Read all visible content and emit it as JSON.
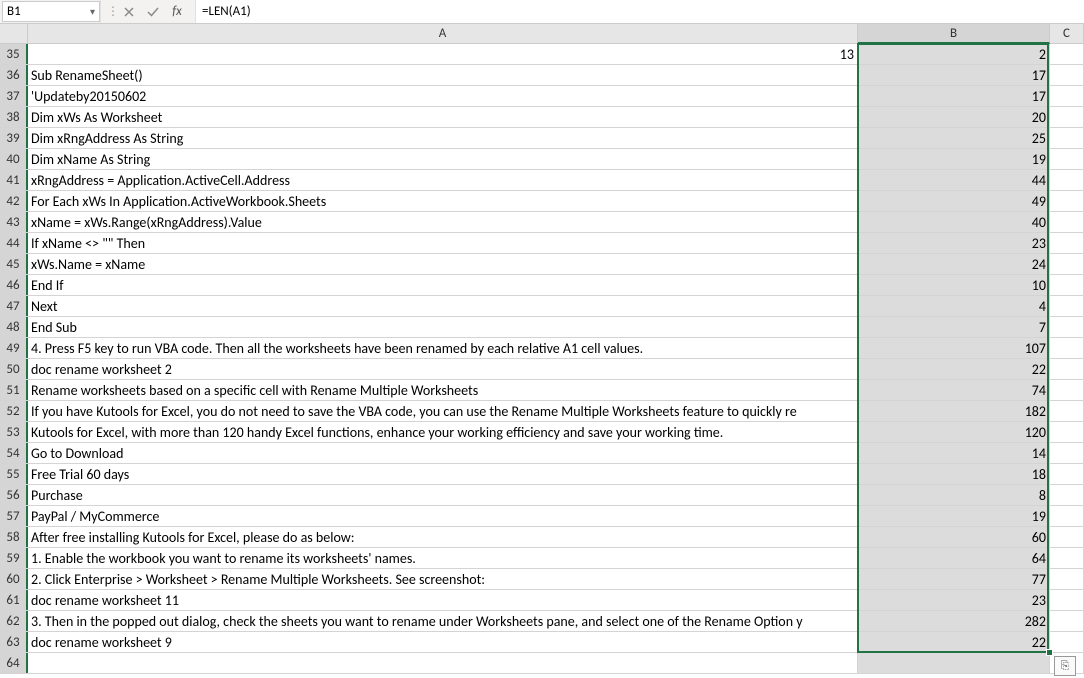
{
  "nameBox": "B1",
  "formula": "=LEN(A1)",
  "cols": [
    {
      "id": "A",
      "label": "A",
      "cls": "colA"
    },
    {
      "id": "B",
      "label": "B",
      "cls": "colB"
    },
    {
      "id": "C",
      "label": "C",
      "cls": "colC"
    }
  ],
  "rows": [
    {
      "n": 35,
      "A": "13",
      "Anum": true,
      "B": "2"
    },
    {
      "n": 36,
      "A": "Sub RenameSheet()",
      "B": "17"
    },
    {
      "n": 37,
      "A": "'Updateby20150602",
      "B": "17"
    },
    {
      "n": 38,
      "A": "Dim xWs As Worksheet",
      "B": "20"
    },
    {
      "n": 39,
      "A": "Dim xRngAddress As String",
      "B": "25"
    },
    {
      "n": 40,
      "A": "Dim xName As String",
      "B": "19"
    },
    {
      "n": 41,
      "A": "xRngAddress = Application.ActiveCell.Address",
      "B": "44"
    },
    {
      "n": 42,
      "A": "For Each xWs In Application.ActiveWorkbook.Sheets",
      "B": "49"
    },
    {
      "n": 43,
      "A": "    xName = xWs.Range(xRngAddress).Value",
      "B": "40"
    },
    {
      "n": 44,
      "A": "    If xName <> \"\" Then",
      "B": "23"
    },
    {
      "n": 45,
      "A": "        xWs.Name = xName",
      "B": "24"
    },
    {
      "n": 46,
      "A": "    End If",
      "B": "10"
    },
    {
      "n": 47,
      "A": "Next",
      "B": "4"
    },
    {
      "n": 48,
      "A": "End Sub",
      "B": "7"
    },
    {
      "n": 49,
      "A": "4. Press F5 key to run VBA code. Then all the worksheets have been renamed by each relative A1 cell values.",
      "B": "107"
    },
    {
      "n": 50,
      "A": "doc rename worksheet 2",
      "B": "22"
    },
    {
      "n": 51,
      "A": "Rename worksheets based on a specific cell with Rename Multiple Worksheets",
      "B": "74"
    },
    {
      "n": 52,
      "A": "If you have Kutools for Excel, you do not need to save the VBA code, you can use the Rename Multiple Worksheets feature to quickly re",
      "B": "182"
    },
    {
      "n": 53,
      "A": "Kutools for Excel, with more than 120 handy Excel functions, enhance your working efficiency and save your working time.",
      "B": "120"
    },
    {
      "n": 54,
      "A": "Go to Download",
      "B": "14"
    },
    {
      "n": 55,
      "A": "Free Trial 60 days",
      "B": "18"
    },
    {
      "n": 56,
      "A": "Purchase",
      "B": "8"
    },
    {
      "n": 57,
      "A": "PayPal / MyCommerce",
      "B": "19"
    },
    {
      "n": 58,
      "A": "After free installing Kutools for Excel, please do as below:",
      "B": "60"
    },
    {
      "n": 59,
      "A": "1. Enable the workbook you want to rename its worksheets' names.",
      "B": "64"
    },
    {
      "n": 60,
      "A": "2. Click Enterprise > Worksheet > Rename Multiple Worksheets. See screenshot:",
      "B": "77"
    },
    {
      "n": 61,
      "A": "doc rename worksheet 11",
      "B": "23"
    },
    {
      "n": 62,
      "A": "3. Then in the popped out dialog, check the sheets you want to rename under Worksheets pane, and select one of the Rename Option y",
      "B": "282"
    },
    {
      "n": 63,
      "A": "doc rename worksheet 9",
      "B": "22"
    },
    {
      "n": 64,
      "A": "",
      "B": ""
    }
  ],
  "pasteIconLabel": "⎘"
}
